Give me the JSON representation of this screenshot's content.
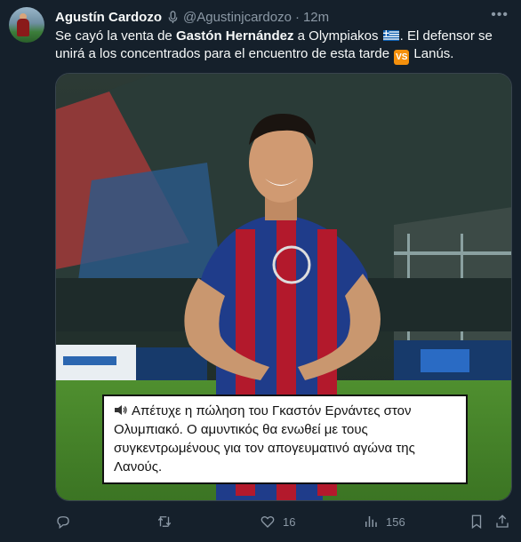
{
  "tweet": {
    "author_name": "Agustín Cardozo",
    "author_handle": "@Agustinjcardozo",
    "separator": "·",
    "time": "12m",
    "text": {
      "p1": "Se cayó la venta de ",
      "bold_name": "Gastón Hernández",
      "p2": " a Olympiakos ",
      "p3": ". El defensor se unirá a los concentrados para el encuentro de esta tarde ",
      "vs": "VS",
      "p4": " Lanús."
    },
    "icons": {
      "verified": "microphone-badge-icon",
      "flag": "greece-flag-icon",
      "vs": "vs-button-icon",
      "more": "more-dots-icon"
    },
    "media": {
      "caption": "Απέτυχε η πώληση του Γκαστόν Ερνάντες στον Ολυμπιακό. Ο αμυντικός θα ενωθεί με τους συγκεντρωμένους για τον απογευματινό αγώνα της Λανούς.",
      "caption_icon": "speaker-icon"
    },
    "actions": {
      "reply_count": "",
      "retweet_count": "",
      "like_count": "16",
      "views_count": "156"
    }
  },
  "colors": {
    "background": "#15202b",
    "text": "#f7f9f9",
    "muted": "#8b98a5",
    "border": "#38444d",
    "vs_badge": "#f4900c"
  }
}
